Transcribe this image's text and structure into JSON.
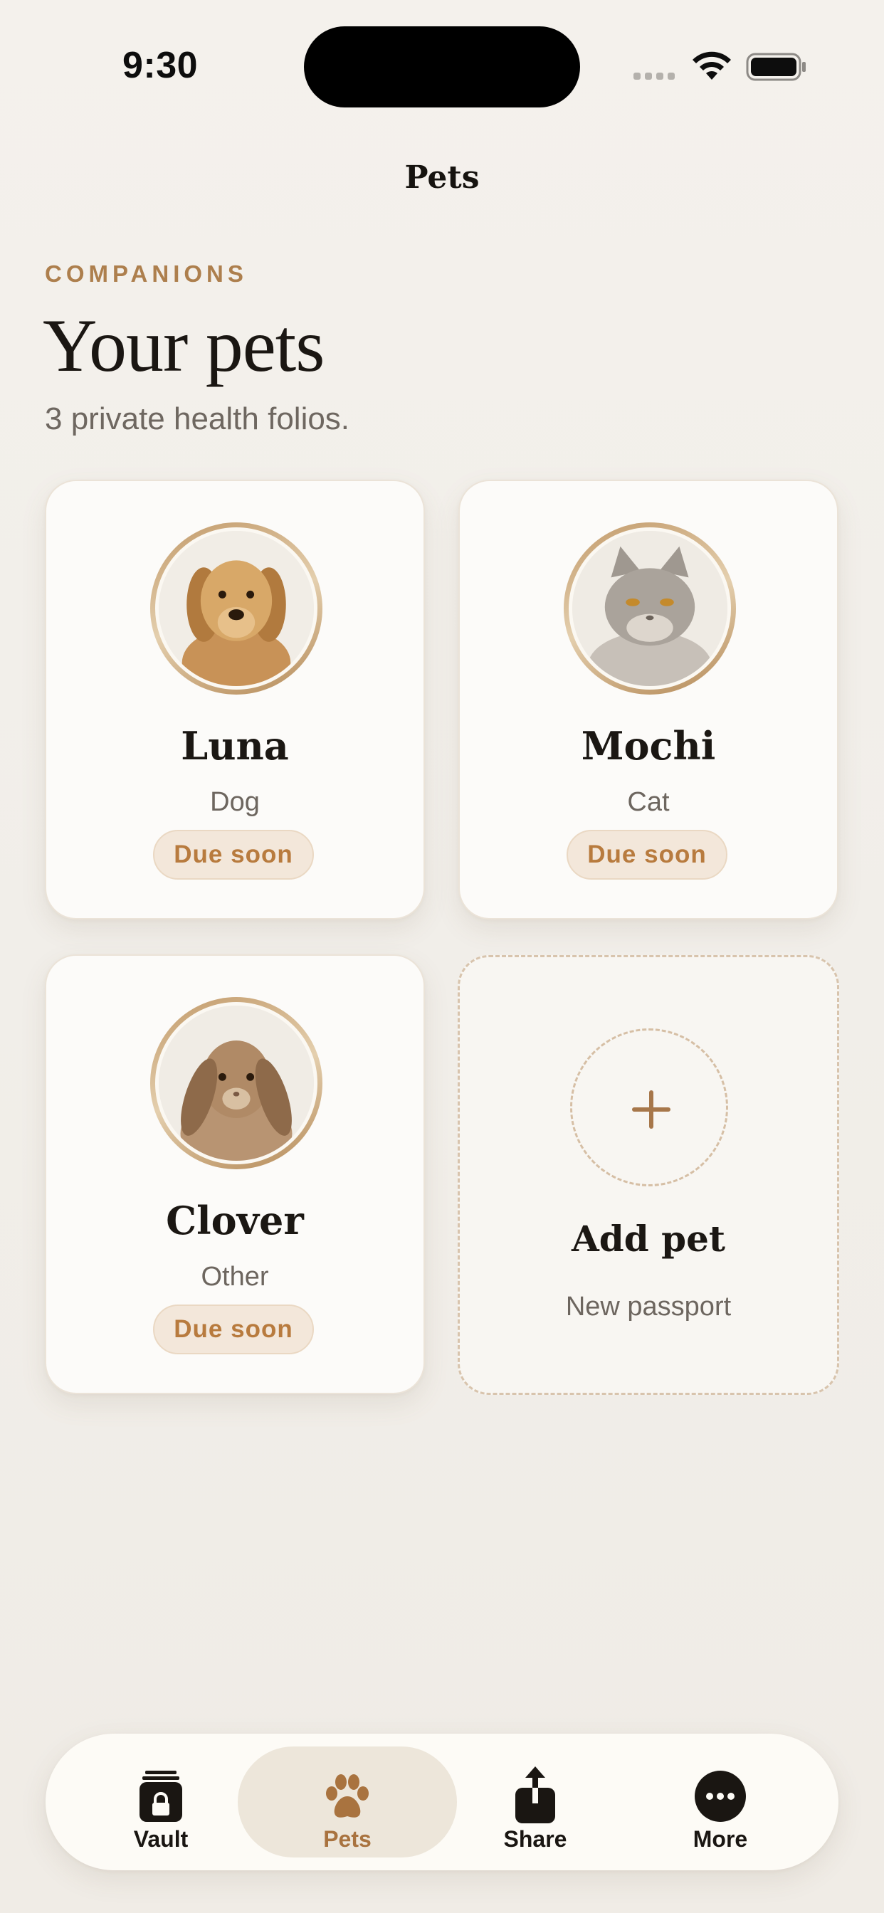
{
  "status_bar": {
    "time": "9:30"
  },
  "nav": {
    "title": "Pets"
  },
  "header": {
    "eyebrow": "COMPANIONS",
    "heading": "Your pets",
    "subtitle": "3 private health folios."
  },
  "pets": [
    {
      "name": "Luna",
      "species": "Dog",
      "status": "Due soon",
      "photo": "golden-retriever-photo"
    },
    {
      "name": "Mochi",
      "species": "Cat",
      "status": "Due soon",
      "photo": "british-shorthair-cat-photo"
    },
    {
      "name": "Clover",
      "species": "Other",
      "status": "Due soon",
      "photo": "lop-rabbit-photo"
    }
  ],
  "add_pet": {
    "title": "Add pet",
    "subtitle": "New passport",
    "icon": "plus-icon"
  },
  "tabbar": {
    "active": "Pets",
    "items": [
      {
        "label": "Vault",
        "icon": "lock-icon"
      },
      {
        "label": "Pets",
        "icon": "paw-icon"
      },
      {
        "label": "Share",
        "icon": "share-icon"
      },
      {
        "label": "More",
        "icon": "more-icon"
      }
    ]
  },
  "colors": {
    "accent": "#ad7f4d",
    "badge_text": "#b87b3e",
    "badge_bg": "#f3e7da",
    "background": "#f2efea"
  }
}
